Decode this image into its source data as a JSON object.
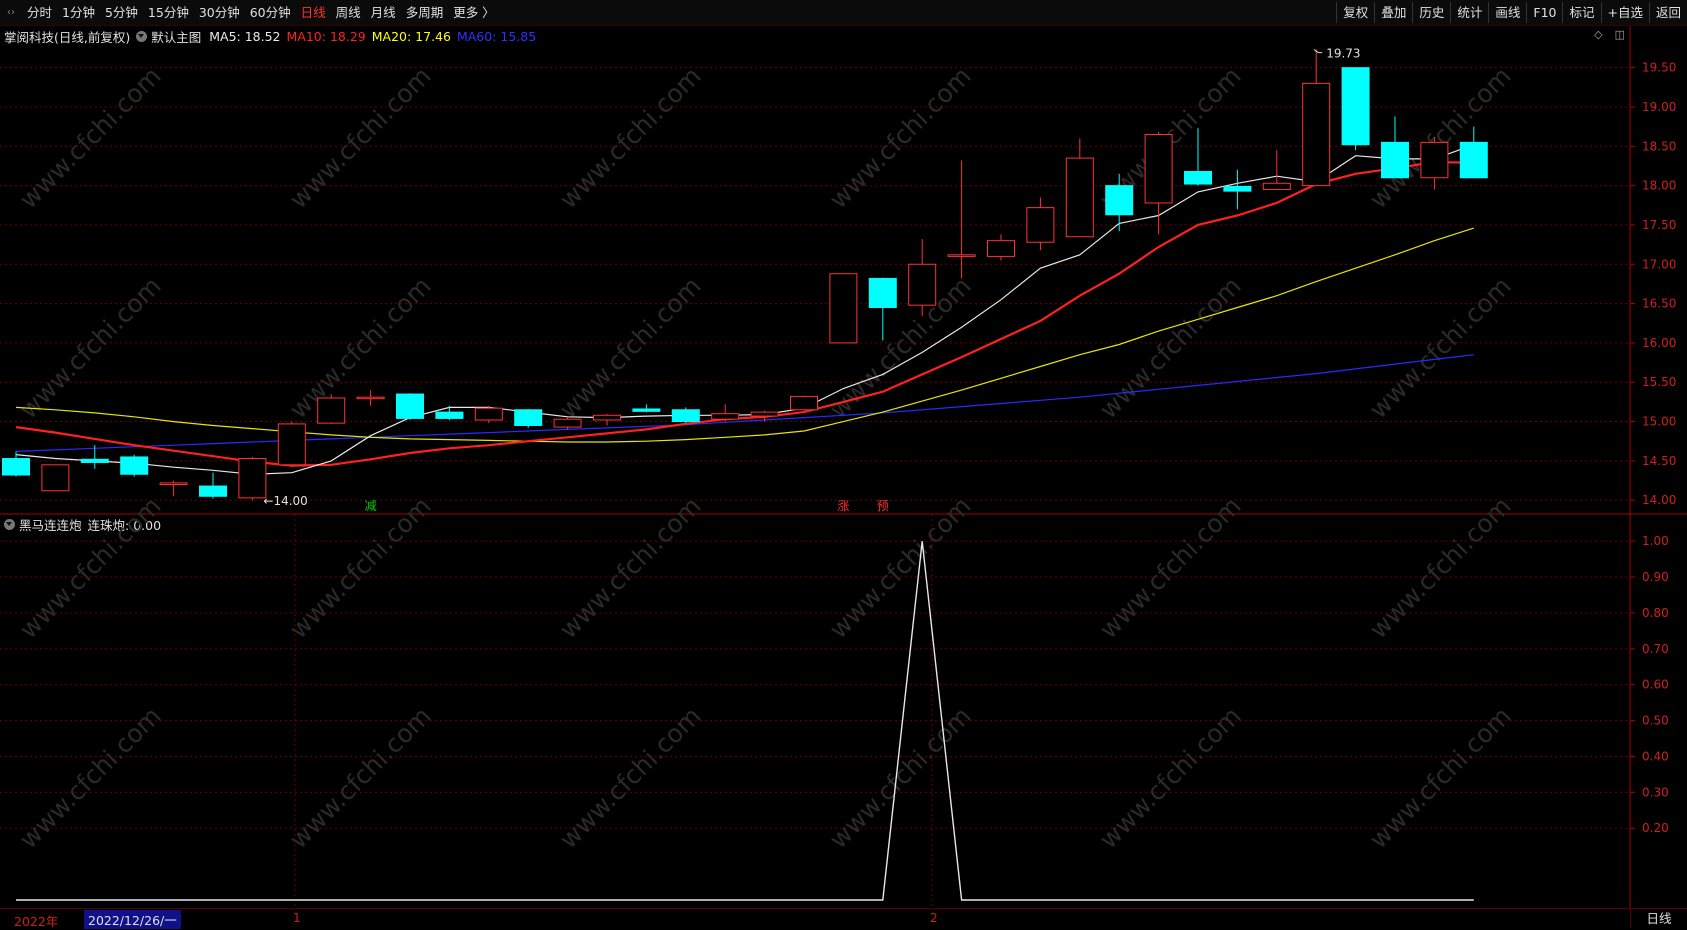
{
  "topbar": {
    "corner_glyph": "‹›",
    "periods": [
      {
        "label": "分时",
        "active": false
      },
      {
        "label": "1分钟",
        "active": false
      },
      {
        "label": "5分钟",
        "active": false
      },
      {
        "label": "15分钟",
        "active": false
      },
      {
        "label": "30分钟",
        "active": false
      },
      {
        "label": "60分钟",
        "active": false
      },
      {
        "label": "日线",
        "active": true
      },
      {
        "label": "周线",
        "active": false
      },
      {
        "label": "月线",
        "active": false
      },
      {
        "label": "多周期",
        "active": false
      },
      {
        "label": "更多 〉",
        "active": false
      }
    ],
    "tools": [
      "复权",
      "叠加",
      "历史",
      "统计",
      "画线",
      "F10",
      "标记",
      "+自选",
      "返回"
    ]
  },
  "main_panel": {
    "stock_title": "掌阅科技(日线,前复权)",
    "indicator": "默认主图",
    "ma": [
      {
        "label": "MA5: 18.52",
        "color": "#e8e8e8"
      },
      {
        "label": "MA10: 18.29",
        "color": "#ff2020"
      },
      {
        "label": "MA20: 17.46",
        "color": "#ffff00"
      },
      {
        "label": "MA60: 15.85",
        "color": "#3030ff"
      }
    ],
    "icons": [
      "diamond-icon",
      "panel-toggle-icon"
    ]
  },
  "sub_panel": {
    "indicator": "黑马连连炮",
    "value_label": "连珠炮: 0.00"
  },
  "bottombar": {
    "year": "2022年",
    "date": "2022/12/26/一",
    "marker1": "1",
    "marker2": "2",
    "period": "日线"
  },
  "watermark": "www.cfchi.com",
  "colors": {
    "up": "#ff3232",
    "down": "#00ffff",
    "ma5": "#e8e8e8",
    "ma10": "#ff2020",
    "ma20": "#e6e600",
    "ma60": "#2a2aff",
    "grid": "#6a0000"
  },
  "chart_data": [
    {
      "type": "candlestick",
      "ylim": [
        13.85,
        19.75
      ],
      "yticks": [
        "19.50",
        "19.00",
        "18.50",
        "18.00",
        "17.50",
        "17.00",
        "16.50",
        "16.00",
        "15.50",
        "15.00",
        "14.50",
        "14.00"
      ],
      "annotations": [
        {
          "label": "19.73",
          "index": 33,
          "value": 19.73
        },
        {
          "label": "←14.00",
          "index": 6,
          "value": 14.0
        }
      ],
      "signals": [
        {
          "label": "减",
          "index": 9,
          "color": "#00d000"
        },
        {
          "label": "涨",
          "index": 21,
          "color": "#ff3030"
        },
        {
          "label": "预",
          "index": 22,
          "color": "#ff3030"
        }
      ],
      "candles": [
        {
          "o": 14.53,
          "h": 14.62,
          "l": 14.3,
          "c": 14.32
        },
        {
          "o": 14.12,
          "h": 14.45,
          "l": 14.12,
          "c": 14.45
        },
        {
          "o": 14.52,
          "h": 14.7,
          "l": 14.4,
          "c": 14.48
        },
        {
          "o": 14.55,
          "h": 14.58,
          "l": 14.3,
          "c": 14.33
        },
        {
          "o": 14.2,
          "h": 14.25,
          "l": 14.05,
          "c": 14.22
        },
        {
          "o": 14.18,
          "h": 14.35,
          "l": 14.02,
          "c": 14.05
        },
        {
          "o": 14.03,
          "h": 14.55,
          "l": 14.0,
          "c": 14.53
        },
        {
          "o": 14.45,
          "h": 15.0,
          "l": 14.42,
          "c": 14.97
        },
        {
          "o": 14.98,
          "h": 15.35,
          "l": 14.97,
          "c": 15.3
        },
        {
          "o": 15.3,
          "h": 15.4,
          "l": 15.2,
          "c": 15.31
        },
        {
          "o": 15.35,
          "h": 15.36,
          "l": 15.02,
          "c": 15.04
        },
        {
          "o": 15.12,
          "h": 15.2,
          "l": 15.02,
          "c": 15.04
        },
        {
          "o": 15.02,
          "h": 15.2,
          "l": 14.98,
          "c": 15.17
        },
        {
          "o": 15.15,
          "h": 15.16,
          "l": 14.92,
          "c": 14.95
        },
        {
          "o": 14.93,
          "h": 15.05,
          "l": 14.9,
          "c": 15.03
        },
        {
          "o": 15.02,
          "h": 15.1,
          "l": 14.95,
          "c": 15.08
        },
        {
          "o": 15.16,
          "h": 15.22,
          "l": 15.12,
          "c": 15.13
        },
        {
          "o": 15.15,
          "h": 15.18,
          "l": 14.98,
          "c": 15.0
        },
        {
          "o": 15.03,
          "h": 15.22,
          "l": 15.0,
          "c": 15.1
        },
        {
          "o": 15.07,
          "h": 15.14,
          "l": 15.0,
          "c": 15.12
        },
        {
          "o": 15.15,
          "h": 15.33,
          "l": 15.14,
          "c": 15.32
        },
        {
          "o": 16.0,
          "h": 16.88,
          "l": 16.0,
          "c": 16.88
        },
        {
          "o": 16.82,
          "h": 16.83,
          "l": 16.03,
          "c": 16.45
        },
        {
          "o": 16.48,
          "h": 17.32,
          "l": 16.34,
          "c": 17.0
        },
        {
          "o": 17.1,
          "h": 18.32,
          "l": 16.82,
          "c": 17.12
        },
        {
          "o": 17.1,
          "h": 17.38,
          "l": 17.05,
          "c": 17.3
        },
        {
          "o": 17.28,
          "h": 17.85,
          "l": 17.18,
          "c": 17.72
        },
        {
          "o": 17.35,
          "h": 18.6,
          "l": 17.35,
          "c": 18.35
        },
        {
          "o": 18.0,
          "h": 18.15,
          "l": 17.42,
          "c": 17.63
        },
        {
          "o": 17.78,
          "h": 18.68,
          "l": 17.38,
          "c": 18.65
        },
        {
          "o": 18.18,
          "h": 18.73,
          "l": 18.0,
          "c": 18.02
        },
        {
          "o": 17.99,
          "h": 18.2,
          "l": 17.7,
          "c": 17.93
        },
        {
          "o": 17.95,
          "h": 18.45,
          "l": 17.94,
          "c": 18.03
        },
        {
          "o": 18.0,
          "h": 19.73,
          "l": 18.0,
          "c": 19.3
        },
        {
          "o": 19.5,
          "h": 19.5,
          "l": 18.45,
          "c": 18.52
        },
        {
          "o": 18.55,
          "h": 18.88,
          "l": 18.1,
          "c": 18.1
        },
        {
          "o": 18.1,
          "h": 18.62,
          "l": 17.95,
          "c": 18.55
        },
        {
          "o": 18.55,
          "h": 18.75,
          "l": 18.1,
          "c": 18.1
        }
      ],
      "ma5": [
        14.58,
        14.53,
        14.5,
        14.47,
        14.42,
        14.38,
        14.33,
        14.35,
        14.5,
        14.82,
        15.05,
        15.18,
        15.18,
        15.12,
        15.06,
        15.05,
        15.07,
        15.08,
        15.08,
        15.09,
        15.17,
        15.42,
        15.6,
        15.88,
        16.2,
        16.55,
        16.95,
        17.12,
        17.52,
        17.62,
        17.92,
        18.03,
        18.12,
        18.05,
        18.38,
        18.34,
        18.34,
        18.52
      ],
      "ma10": [
        14.93,
        14.86,
        14.78,
        14.7,
        14.63,
        14.56,
        14.49,
        14.44,
        14.45,
        14.52,
        14.6,
        14.66,
        14.7,
        14.75,
        14.8,
        14.85,
        14.9,
        14.97,
        15.03,
        15.06,
        15.12,
        15.25,
        15.38,
        15.6,
        15.82,
        16.05,
        16.28,
        16.6,
        16.88,
        17.22,
        17.5,
        17.62,
        17.78,
        18.02,
        18.15,
        18.22,
        18.3,
        18.29
      ],
      "ma20": [
        15.18,
        15.15,
        15.11,
        15.06,
        15.0,
        14.95,
        14.91,
        14.87,
        14.83,
        14.8,
        14.78,
        14.77,
        14.76,
        14.75,
        14.74,
        14.74,
        14.75,
        14.77,
        14.8,
        14.83,
        14.88,
        15.0,
        15.12,
        15.26,
        15.4,
        15.55,
        15.7,
        15.85,
        15.98,
        16.15,
        16.3,
        16.45,
        16.6,
        16.78,
        16.95,
        17.12,
        17.3,
        17.46
      ],
      "ma60": [
        14.62,
        14.64,
        14.66,
        14.68,
        14.7,
        14.72,
        14.74,
        14.76,
        14.78,
        14.8,
        14.82,
        14.84,
        14.86,
        14.88,
        14.9,
        14.92,
        14.94,
        14.96,
        14.99,
        15.02,
        15.05,
        15.08,
        15.11,
        15.15,
        15.19,
        15.23,
        15.27,
        15.31,
        15.36,
        15.41,
        15.46,
        15.51,
        15.56,
        15.61,
        15.67,
        15.73,
        15.79,
        15.85
      ]
    },
    {
      "type": "line",
      "series": [
        {
          "name": "连珠炮",
          "values": [
            0,
            0,
            0,
            0,
            0,
            0,
            0,
            0,
            0,
            0,
            0,
            0,
            0,
            0,
            0,
            0,
            0,
            0,
            0,
            0,
            0,
            0,
            0,
            1,
            0,
            0,
            0,
            0,
            0,
            0,
            0,
            0,
            0,
            0,
            0,
            0,
            0,
            0
          ]
        }
      ],
      "ylim": [
        0,
        1.02
      ],
      "yticks": [
        "1.00",
        "0.90",
        "0.80",
        "0.70",
        "0.60",
        "0.50",
        "0.40",
        "0.30",
        "0.20"
      ]
    }
  ]
}
